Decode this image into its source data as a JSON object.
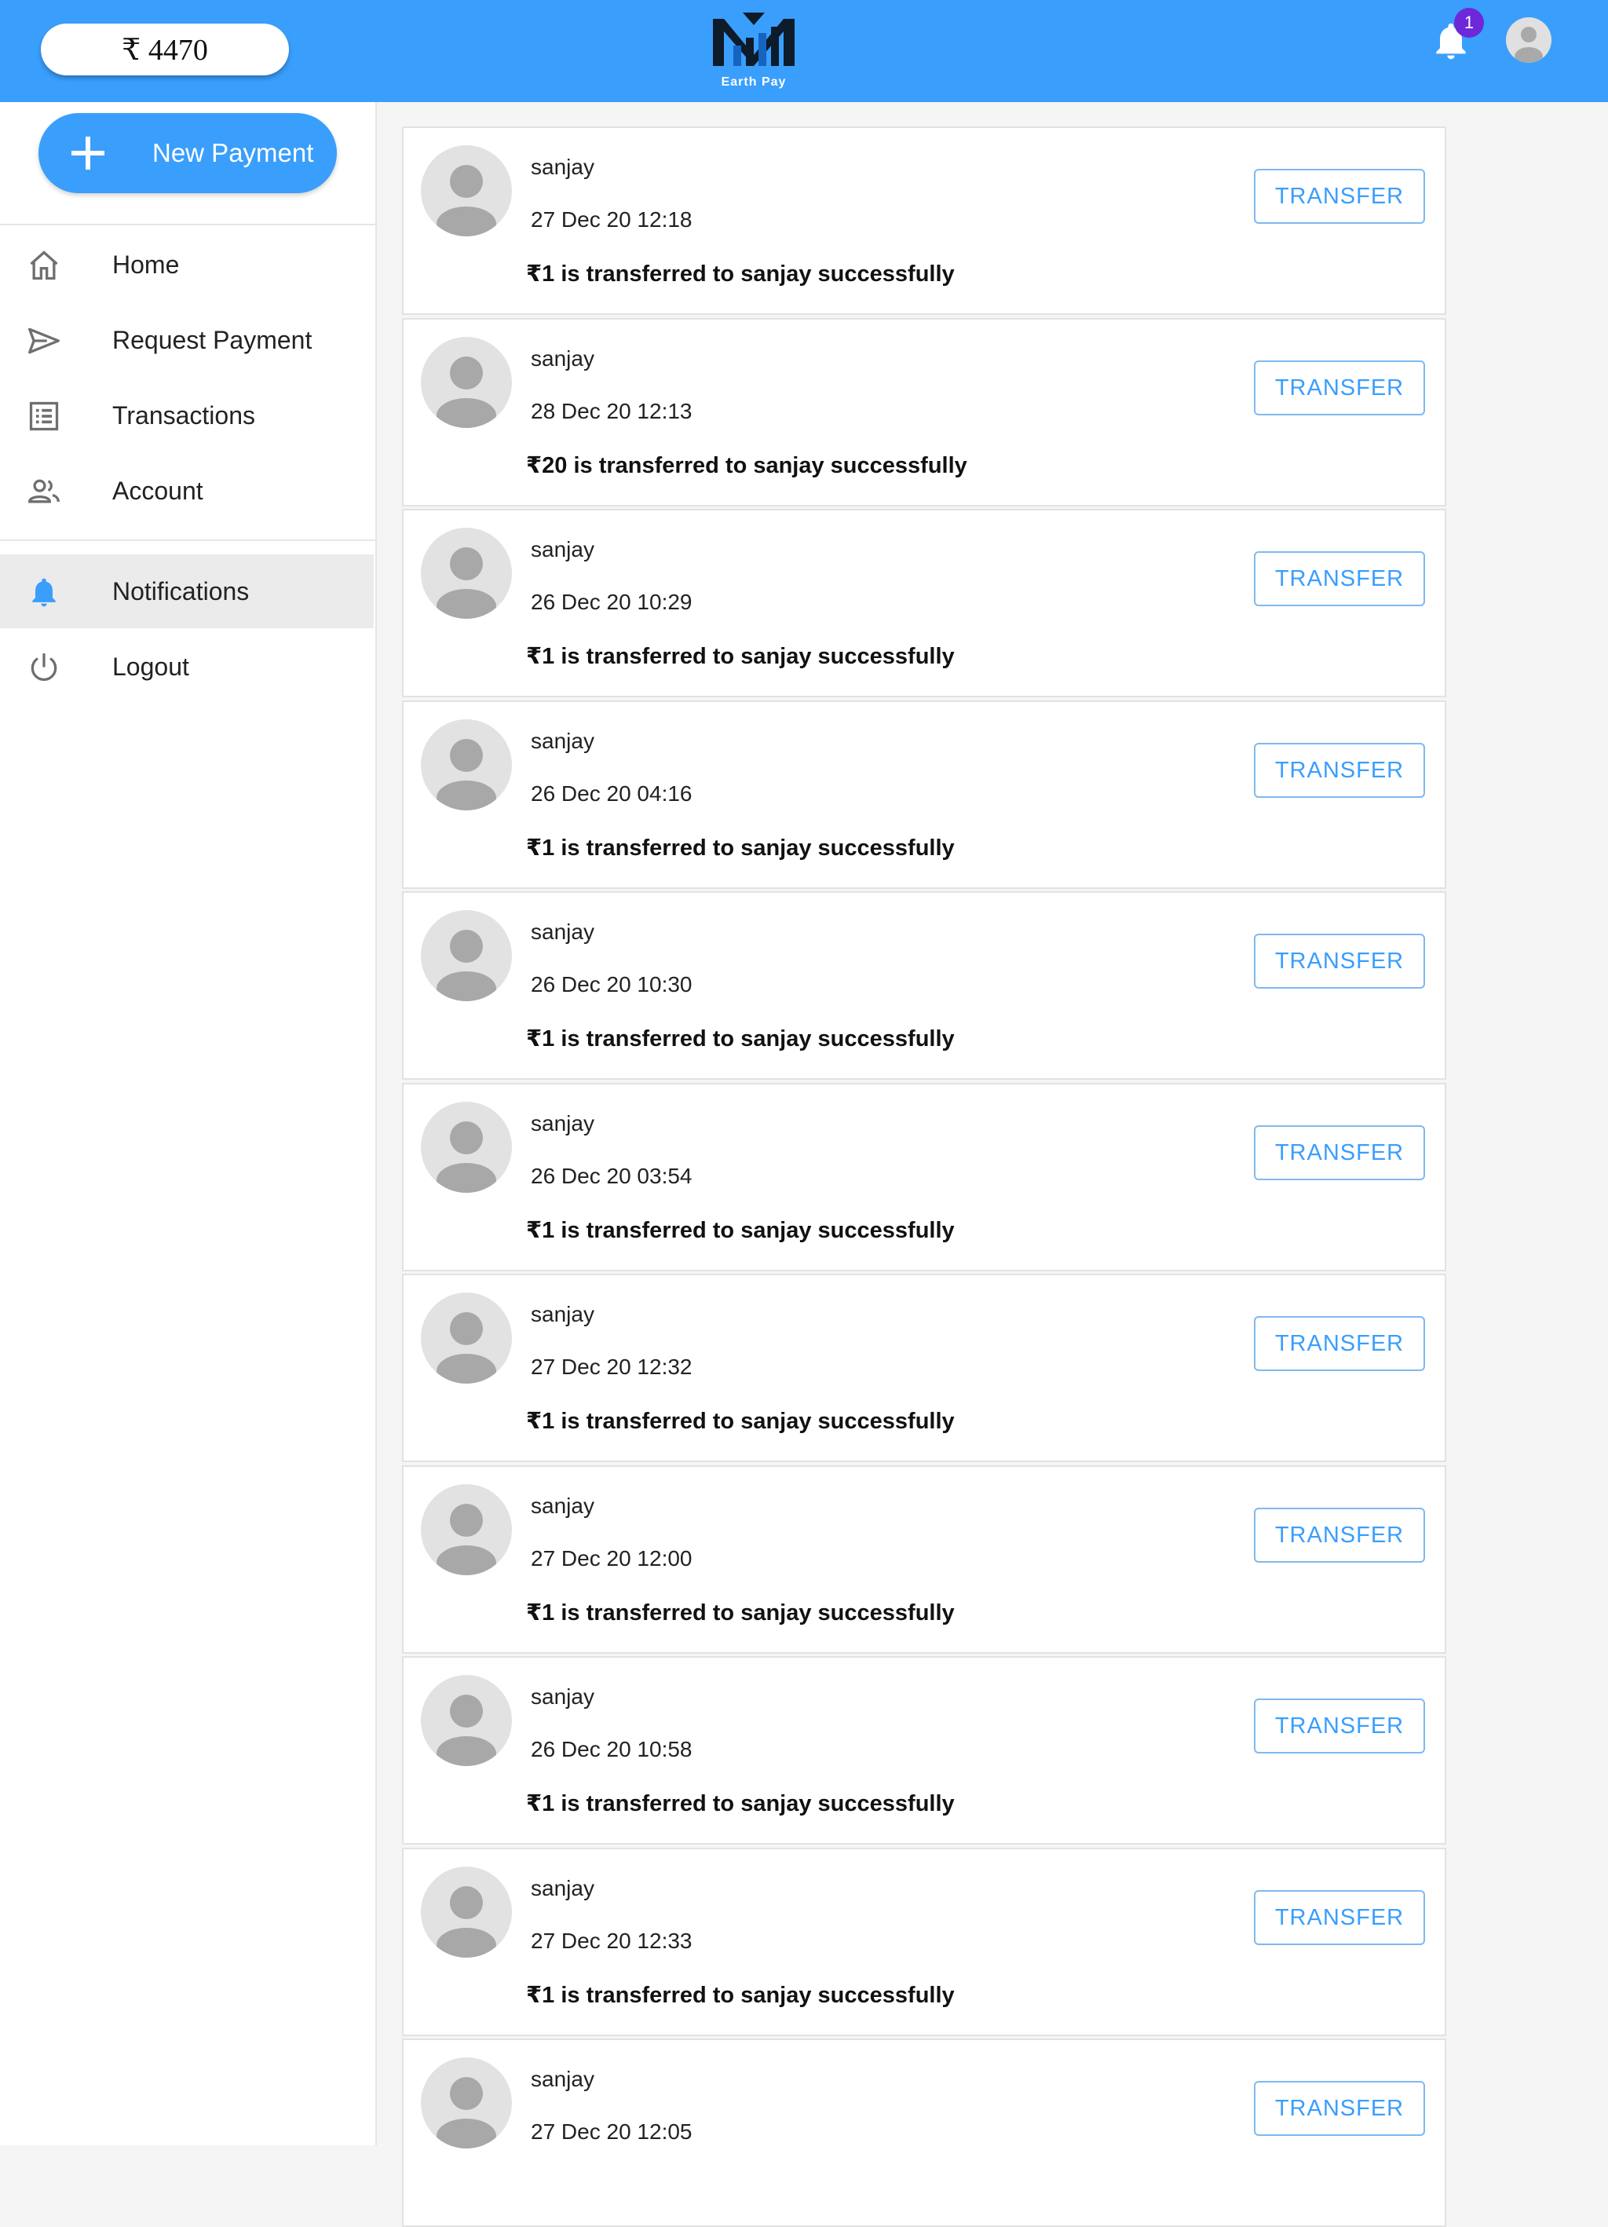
{
  "header": {
    "balance": "₹ 4470",
    "logo_text": "Earth Pay",
    "notification_count": "1",
    "colors": {
      "primary": "#3a9efc",
      "badge": "#6d28d9"
    }
  },
  "sidebar": {
    "new_payment_label": "New Payment",
    "items": [
      {
        "label": "Home",
        "icon": "home-icon"
      },
      {
        "label": "Request Payment",
        "icon": "send-icon"
      },
      {
        "label": "Transactions",
        "icon": "list-icon"
      },
      {
        "label": "Account",
        "icon": "people-icon"
      }
    ],
    "secondary_items": [
      {
        "label": "Notifications",
        "icon": "bell-icon",
        "active": true
      },
      {
        "label": "Logout",
        "icon": "power-icon"
      }
    ]
  },
  "notifications": {
    "button_label": "TRANSFER",
    "items": [
      {
        "name": "sanjay",
        "date": "27 Dec 20 12:18",
        "message": "₹1 is transferred to sanjay successfully"
      },
      {
        "name": "sanjay",
        "date": "28 Dec 20 12:13",
        "message": "₹20 is transferred to sanjay successfully"
      },
      {
        "name": "sanjay",
        "date": "26 Dec 20 10:29",
        "message": "₹1 is transferred to sanjay successfully"
      },
      {
        "name": "sanjay",
        "date": "26 Dec 20 04:16",
        "message": "₹1 is transferred to sanjay successfully"
      },
      {
        "name": "sanjay",
        "date": "26 Dec 20 10:30",
        "message": "₹1 is transferred to sanjay successfully"
      },
      {
        "name": "sanjay",
        "date": "26 Dec 20 03:54",
        "message": "₹1 is transferred to sanjay successfully"
      },
      {
        "name": "sanjay",
        "date": "27 Dec 20 12:32",
        "message": "₹1 is transferred to sanjay successfully"
      },
      {
        "name": "sanjay",
        "date": "27 Dec 20 12:00",
        "message": "₹1 is transferred to sanjay successfully"
      },
      {
        "name": "sanjay",
        "date": "26 Dec 20 10:58",
        "message": "₹1 is transferred to sanjay successfully"
      },
      {
        "name": "sanjay",
        "date": "27 Dec 20 12:33",
        "message": "₹1 is transferred to sanjay successfully"
      },
      {
        "name": "sanjay",
        "date": "27 Dec 20 12:05",
        "message": ""
      }
    ]
  }
}
